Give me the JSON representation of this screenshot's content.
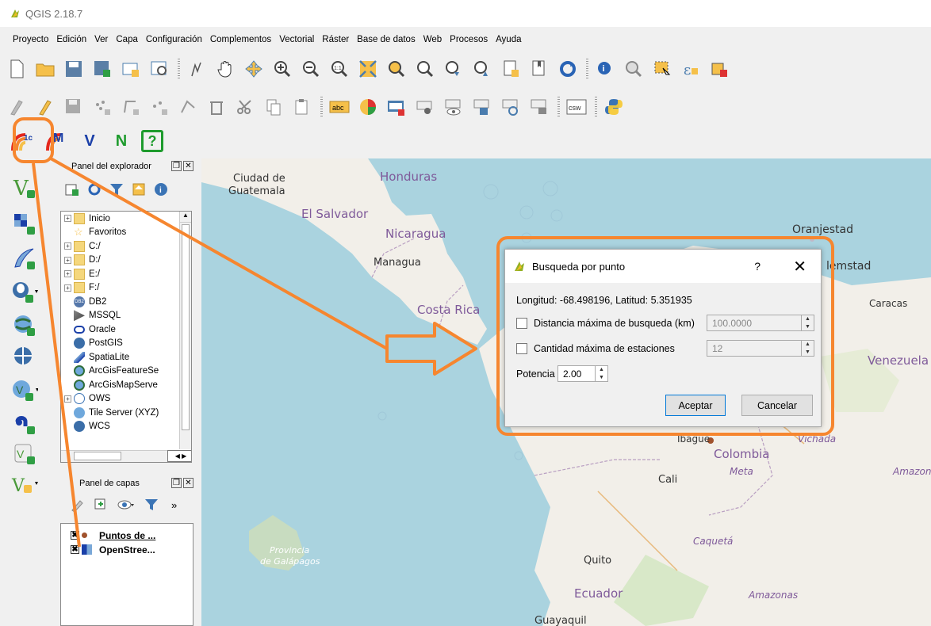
{
  "window": {
    "title": "QGIS 2.18.7"
  },
  "menu": [
    "Proyecto",
    "Edición",
    "Ver",
    "Capa",
    "Configuración",
    "Complementos",
    "Vectorial",
    "Ráster",
    "Base de datos",
    "Web",
    "Procesos",
    "Ayuda"
  ],
  "toolbar3": {
    "plugins": [
      "1c",
      "M",
      "V",
      "N",
      "?"
    ]
  },
  "toolbar2": {
    "labels": [
      "abc",
      "csw"
    ]
  },
  "browser": {
    "title": "Panel del explorador",
    "items": [
      "Inicio",
      "Favoritos",
      "C:/",
      "D:/",
      "E:/",
      "F:/",
      "DB2",
      "MSSQL",
      "Oracle",
      "PostGIS",
      "SpatiaLite",
      "ArcGisFeatureSe",
      "ArcGisMapServe",
      "OWS",
      "Tile Server (XYZ)",
      "WCS"
    ],
    "db2_badge": "DB2"
  },
  "layers_panel": {
    "title": "Panel de capas",
    "more": "»",
    "layers": [
      "Puntos de ...",
      "OpenStree..."
    ]
  },
  "map_labels": {
    "ciudad_de": "Ciudad de",
    "guatemala": "Guatemala",
    "honduras": "Honduras",
    "el_salvador": "El Salvador",
    "nicaragua": "Nicaragua",
    "managua": "Managua",
    "costa_rica": "Costa Rica",
    "oranjestad": "Oranjestad",
    "willemstad": "lemstad",
    "caracas": "Caracas",
    "venezuela": "Venezuela",
    "ibague": "Ibagué",
    "vichada": "Vichada",
    "colombia": "Colombia",
    "meta": "Meta",
    "amazon": "Amazon",
    "cali": "Cali",
    "caqueta": "Caquetá",
    "provincia": "Provincia",
    "galapagos": "de Galápagos",
    "quito": "Quito",
    "ecuador": "Ecuador",
    "amazonas": "Amazonas",
    "guayaquil": "Guayaquil"
  },
  "dialog": {
    "title": "Busqueda por punto",
    "help": "?",
    "close": "✕",
    "coords": "Longitud: -68.498196, Latitud: 5.351935",
    "dist_label": "Distancia máxima de busqueda (km)",
    "dist_value": "100.0000",
    "count_label": "Cantidad máxima de estaciones",
    "count_value": "12",
    "power_label": "Potencia",
    "power_value": "2.00",
    "accept": "Aceptar",
    "cancel": "Cancelar"
  },
  "colors": {
    "accent": "#f6862f",
    "sea": "#aad3df",
    "land": "#f2efe9"
  }
}
